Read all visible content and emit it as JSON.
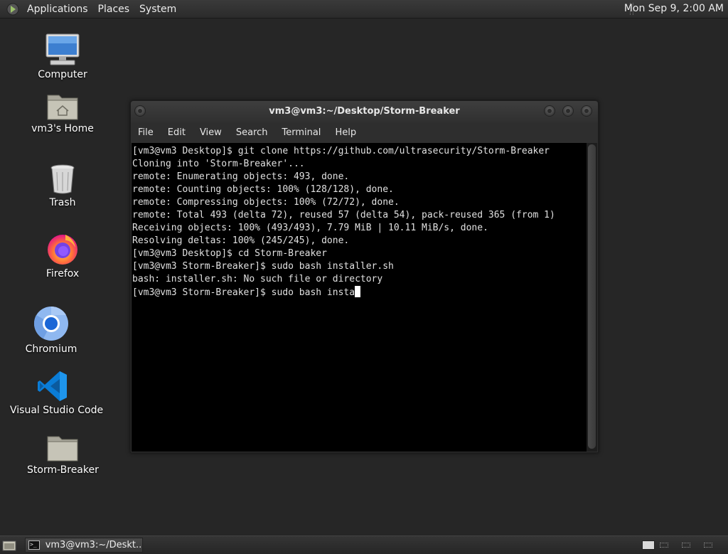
{
  "top_panel": {
    "menus": [
      "Applications",
      "Places",
      "System"
    ],
    "clock": "Mon Sep  9,  2:00 AM"
  },
  "desktop_icons": [
    {
      "label": "Computer",
      "icon": "computer-icon"
    },
    {
      "label": "vm3's Home",
      "icon": "home-folder-icon"
    },
    {
      "label": "Trash",
      "icon": "trash-icon"
    },
    {
      "label": "Firefox",
      "icon": "firefox-icon"
    },
    {
      "label": "Chromium",
      "icon": "chromium-icon"
    },
    {
      "label": "Visual Studio Code",
      "icon": "vscode-icon"
    },
    {
      "label": "Storm-Breaker",
      "icon": "folder-icon"
    }
  ],
  "terminal": {
    "title": "vm3@vm3:~/Desktop/Storm-Breaker",
    "menus": [
      "File",
      "Edit",
      "View",
      "Search",
      "Terminal",
      "Help"
    ],
    "lines": [
      "[vm3@vm3 Desktop]$ git clone https://github.com/ultrasecurity/Storm-Breaker",
      "Cloning into 'Storm-Breaker'...",
      "remote: Enumerating objects: 493, done.",
      "remote: Counting objects: 100% (128/128), done.",
      "remote: Compressing objects: 100% (72/72), done.",
      "remote: Total 493 (delta 72), reused 57 (delta 54), pack-reused 365 (from 1)",
      "Receiving objects: 100% (493/493), 7.79 MiB | 10.11 MiB/s, done.",
      "Resolving deltas: 100% (245/245), done.",
      "[vm3@vm3 Desktop]$ cd Storm-Breaker",
      "[vm3@vm3 Storm-Breaker]$ sudo bash installer.sh",
      "bash: installer.sh: No such file or directory"
    ],
    "current_line": "[vm3@vm3 Storm-Breaker]$ sudo bash insta"
  },
  "taskbar": {
    "window_button": "vm3@vm3:~/Deskt..."
  },
  "colors": {
    "desktop_bg": "#262626",
    "terminal_bg": "#000000",
    "terminal_fg": "#e0e0e0"
  }
}
